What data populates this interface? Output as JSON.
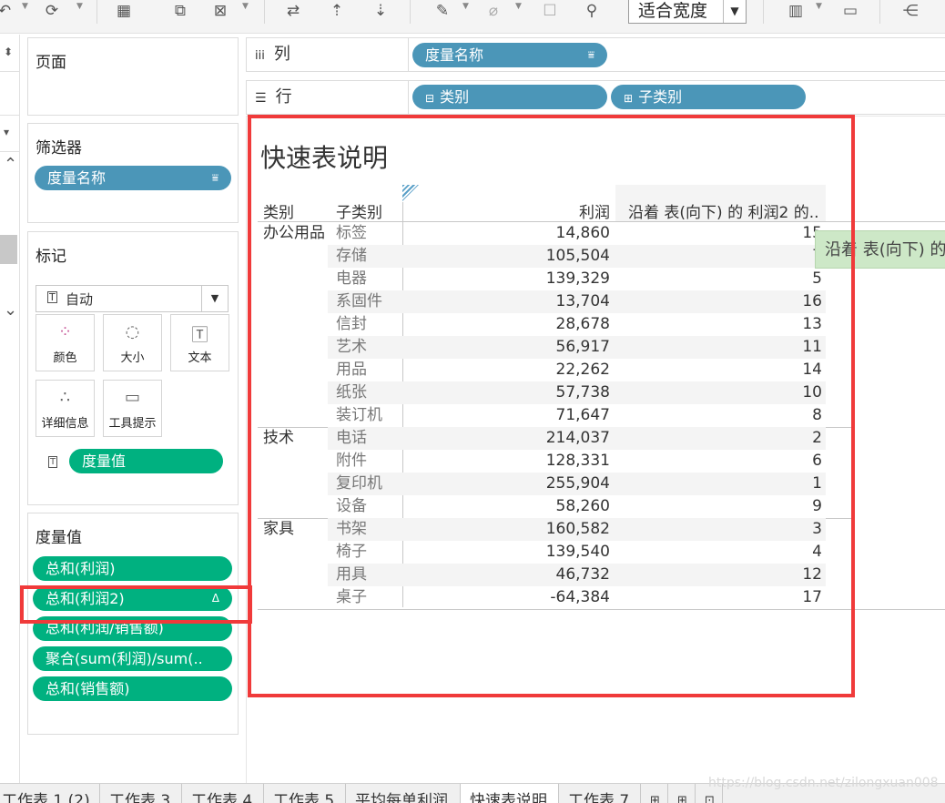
{
  "toolbar": {
    "fit_label": "适合宽度",
    "icons": [
      "undo-icon",
      "redo-icon",
      "new-worksheet-icon",
      "duplicate-icon",
      "clear-sheet-icon",
      "swap-icon",
      "sort-asc-icon",
      "sort-desc-icon",
      "highlight-icon",
      "paperclip-icon",
      "label-icon",
      "pin-icon",
      "show-me-icon",
      "presentation-icon",
      "share-icon"
    ]
  },
  "pages": {
    "title": "页面"
  },
  "filters": {
    "title": "筛选器",
    "pill": "度量名称"
  },
  "marks": {
    "title": "标记",
    "type_value": "自动",
    "buttons": {
      "color": "颜色",
      "size": "大小",
      "text": "文本",
      "detail": "详细信息",
      "tooltip": "工具提示"
    },
    "field": "度量值"
  },
  "measure_values": {
    "title": "度量值",
    "items": [
      "总和(利润)",
      "总和(利润2)",
      "总和(利润/销售额)",
      "聚合(sum(利润)/sum(..",
      "总和(销售额)"
    ],
    "delta_mark": "Δ"
  },
  "shelves": {
    "columns": {
      "label": "列",
      "icon": "iii",
      "pills": [
        "度量名称"
      ]
    },
    "rows": {
      "label": "行",
      "icon": "☰",
      "pills": [
        "类别",
        "子类别"
      ]
    }
  },
  "view": {
    "title": "快速表说明",
    "headers": {
      "category": "类别",
      "subcategory": "子类别",
      "profit": "利润",
      "rank": "沿着 表(向下) 的 利润2 的.."
    },
    "groups": [
      {
        "category": "办公用品",
        "rows": [
          {
            "sub": "标签",
            "profit": "14,860",
            "rank": "15"
          },
          {
            "sub": "存储",
            "profit": "105,504",
            "rank": "7"
          },
          {
            "sub": "电器",
            "profit": "139,329",
            "rank": "5"
          },
          {
            "sub": "系固件",
            "profit": "13,704",
            "rank": "16"
          },
          {
            "sub": "信封",
            "profit": "28,678",
            "rank": "13"
          },
          {
            "sub": "艺术",
            "profit": "56,917",
            "rank": "11"
          },
          {
            "sub": "用品",
            "profit": "22,262",
            "rank": "14"
          },
          {
            "sub": "纸张",
            "profit": "57,738",
            "rank": "10"
          },
          {
            "sub": "装订机",
            "profit": "71,647",
            "rank": "8"
          }
        ]
      },
      {
        "category": "技术",
        "rows": [
          {
            "sub": "电话",
            "profit": "214,037",
            "rank": "2"
          },
          {
            "sub": "附件",
            "profit": "128,331",
            "rank": "6"
          },
          {
            "sub": "复印机",
            "profit": "255,904",
            "rank": "1"
          },
          {
            "sub": "设备",
            "profit": "58,260",
            "rank": "9"
          }
        ]
      },
      {
        "category": "家具",
        "rows": [
          {
            "sub": "书架",
            "profit": "160,582",
            "rank": "3"
          },
          {
            "sub": "椅子",
            "profit": "139,540",
            "rank": "4"
          },
          {
            "sub": "用具",
            "profit": "46,732",
            "rank": "12"
          },
          {
            "sub": "桌子",
            "profit": "-64,384",
            "rank": "17"
          }
        ]
      }
    ],
    "tooltip": "沿着 表(向下) 的"
  },
  "tabs": [
    "工作表 1 (2)",
    "工作表 3",
    "工作表 4",
    "工作表 5",
    "平均每单利润",
    "快速表说明",
    "工作表 7"
  ],
  "active_tab": "快速表说明",
  "watermark": "https://blog.csdn.net/zilongxuan008"
}
